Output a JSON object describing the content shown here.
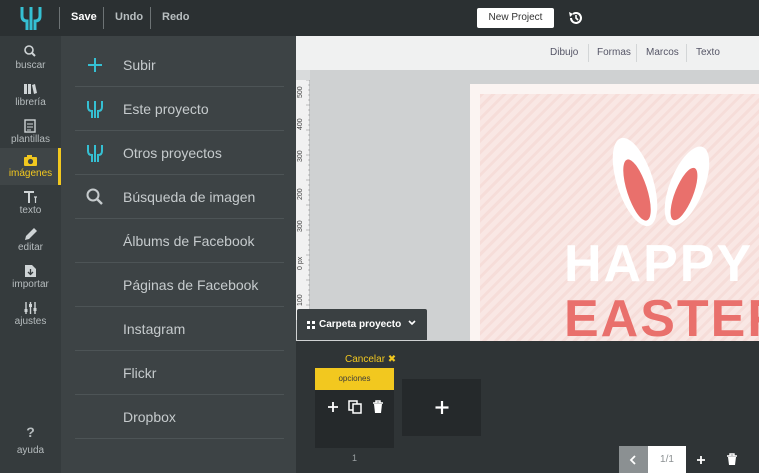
{
  "toolbar": {
    "save_label": "Save",
    "undo_label": "Undo",
    "redo_label": "Redo",
    "new_project_label": "New Project"
  },
  "rail": {
    "items": [
      {
        "label": "buscar",
        "icon": "search-icon"
      },
      {
        "label": "librería",
        "icon": "library-icon"
      },
      {
        "label": "plantillas",
        "icon": "template-icon"
      },
      {
        "label": "imágenes",
        "icon": "camera-icon",
        "active": true
      },
      {
        "label": "texto",
        "icon": "text-icon"
      },
      {
        "label": "editar",
        "icon": "pencil-icon"
      },
      {
        "label": "importar",
        "icon": "import-icon"
      },
      {
        "label": "ajustes",
        "icon": "sliders-icon"
      }
    ],
    "help_label": "ayuda",
    "help_icon_char": "?"
  },
  "panel": {
    "items": [
      {
        "label": "Subir",
        "icon": "plus-icon"
      },
      {
        "label": "Este proyecto",
        "icon": "logo-icon"
      },
      {
        "label": "Otros proyectos",
        "icon": "logo-icon"
      },
      {
        "label": "Búsqueda de imagen",
        "icon": "search-icon"
      },
      {
        "label": "Álbums de Facebook",
        "icon": ""
      },
      {
        "label": "Páginas de Facebook",
        "icon": ""
      },
      {
        "label": "Instagram",
        "icon": ""
      },
      {
        "label": "Flickr",
        "icon": ""
      },
      {
        "label": "Dropbox",
        "icon": ""
      }
    ]
  },
  "canvas": {
    "tabs": [
      "Dibujo",
      "Formas",
      "Marcos",
      "Texto"
    ],
    "ruler_labels": [
      "500",
      "400",
      "300",
      "200",
      "300",
      "0 px",
      "100"
    ],
    "design": {
      "line1": "HAPPY",
      "line2": "EASTER"
    }
  },
  "pages": {
    "folder_label": "Carpeta proyecto",
    "cancel_label": "Cancelar ✖",
    "options_label": "opciones",
    "page_number": "1",
    "counter": "1/1"
  },
  "colors": {
    "accent": "#f2c81f",
    "teal": "#35c0d3",
    "easter_pink": "#e9706c"
  }
}
